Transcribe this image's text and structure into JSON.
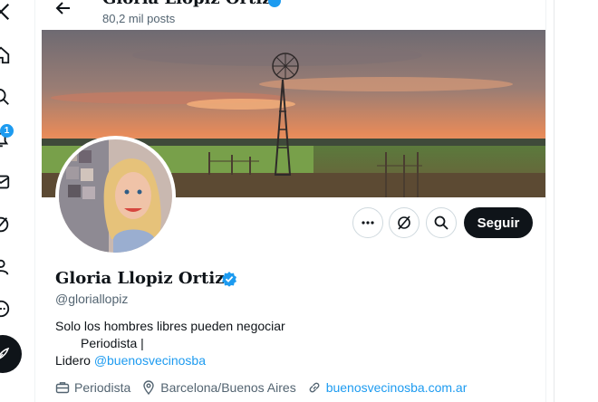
{
  "header": {
    "name": "Gloria Llopiz Ortiz",
    "posts_count": "80,2 mil posts"
  },
  "nav": {
    "badge_count": "1",
    "icons": [
      "x-logo-icon",
      "home-icon",
      "explore-icon",
      "notifications-icon",
      "messages-icon",
      "grok-icon",
      "profile-icon",
      "more-icon",
      "post-icon"
    ]
  },
  "actions": {
    "follow_label": "Seguir"
  },
  "profile": {
    "display_name": "Gloria Llopiz Ortiz",
    "handle": "@gloriallopiz",
    "bio_line1": "Solo los hombres libres pueden negociar",
    "bio_line2": "Periodista |",
    "bio_line3_prefix": "Lidero ",
    "bio_line3_link": "@buenosvecinosba"
  },
  "meta": {
    "profession": "Periodista",
    "location": "Barcelona/Buenos Aires",
    "website": "buenosvecinosba.com.ar"
  },
  "colors": {
    "accent": "#1d9bf0",
    "text_primary": "#0f1419",
    "text_secondary": "#536471",
    "follow_bg": "#0f1419"
  }
}
